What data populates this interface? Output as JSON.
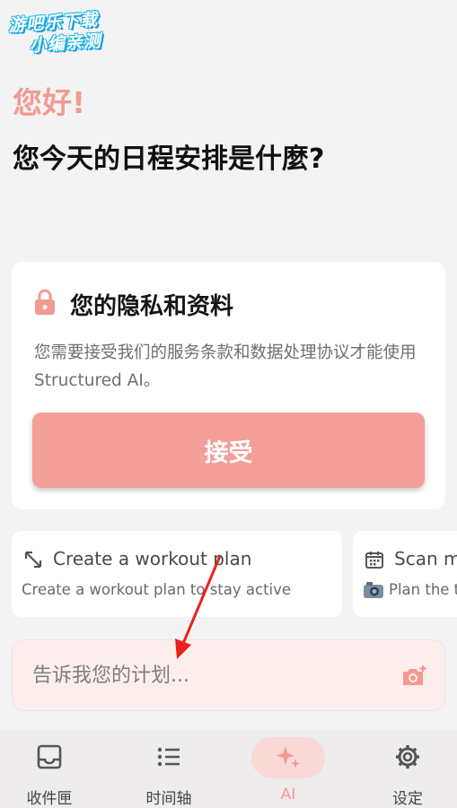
{
  "watermark": {
    "line1": "游吧乐下载",
    "line2": "小编亲测"
  },
  "header": {
    "greeting": "您好!",
    "question": "您今天的日程安排是什麼?"
  },
  "privacy": {
    "title": "您的隐私和资料",
    "body": "您需要接受我们的服务条款和数据处理协议才能使用 Structured AI。",
    "accept_label": "接受",
    "icon": "lock-icon"
  },
  "suggestions": [
    {
      "title": "Create a workout plan",
      "subtitle": "Create a workout plan to stay active",
      "icon": "expand-arrows-icon"
    },
    {
      "title": "Scan m",
      "subtitle": "Plan the t",
      "icon": "calendar-icon"
    }
  ],
  "plan_input": {
    "placeholder": "告诉我您的计划...",
    "icon": "add-photo-icon"
  },
  "nav": {
    "items": [
      {
        "label": "收件匣",
        "icon": "inbox-icon"
      },
      {
        "label": "时间轴",
        "icon": "list-icon"
      },
      {
        "label": "AI",
        "icon": "sparkles-icon",
        "active": true
      },
      {
        "label": "设定",
        "icon": "gear-icon"
      }
    ]
  },
  "colors": {
    "accent": "#f29a92",
    "button": "#f49f98",
    "input_bg": "#fdeeee",
    "annotation_arrow": "#e8231d"
  }
}
